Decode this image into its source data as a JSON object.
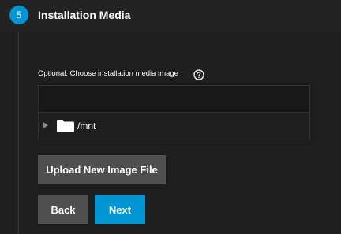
{
  "step": {
    "number": "5",
    "title": "Installation Media"
  },
  "field": {
    "label": "Optional: Choose installation media image",
    "help_icon": "help-circle-icon"
  },
  "explorer": {
    "path_value": "",
    "nodes": [
      {
        "label": "/mnt",
        "icon": "folder-icon",
        "expander_icon": "caret-right-icon"
      }
    ]
  },
  "buttons": {
    "upload": "Upload New Image File",
    "back": "Back",
    "next": "Next"
  },
  "colors": {
    "accent": "#0095d5",
    "background": "#1f1f1f",
    "button_secondary": "#4f4f4f"
  }
}
